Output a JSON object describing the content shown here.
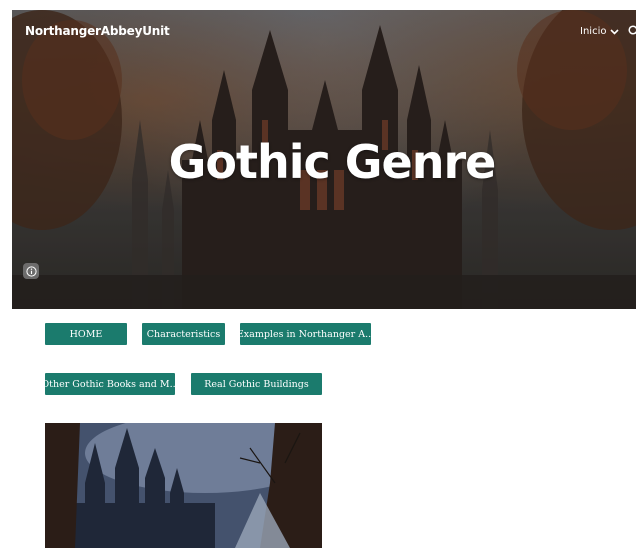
{
  "header": {
    "site_title": "NorthangerAbbeyUnit",
    "nav_label": "Inicio"
  },
  "hero": {
    "title": "Gothic Genre"
  },
  "nav_buttons": {
    "row1": [
      "HOME",
      "Characteristics",
      "Examples in Northanger A..."
    ],
    "row2": [
      "Other Gothic Books and M...",
      "Real Gothic Buildings"
    ]
  },
  "colors": {
    "button_bg": "#1b7b6d",
    "button_text": "#ffffff"
  },
  "icons": [
    "chevron-down-icon",
    "search-icon",
    "info-icon"
  ]
}
